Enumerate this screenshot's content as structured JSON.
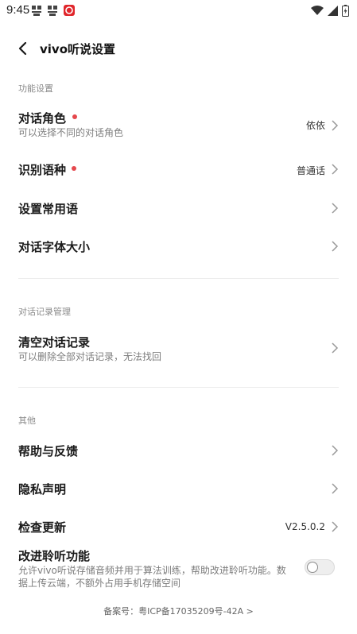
{
  "status_bar": {
    "time": "9:45",
    "icons": [
      "app-notification-icon",
      "app-notification-icon",
      "red-app-icon",
      "wifi-icon",
      "signal-icon",
      "battery-charging-icon"
    ]
  },
  "header": {
    "title": "vivo听说设置",
    "back_icon": "back-arrow-icon"
  },
  "sections": {
    "function": {
      "label": "功能设置"
    },
    "dialog_record": {
      "label": "对话记录管理"
    },
    "other": {
      "label": "其他"
    }
  },
  "items": {
    "role": {
      "label": "对话角色",
      "sub": "可以选择不同的对话角色",
      "value": "依依"
    },
    "language": {
      "label": "识别语种",
      "value": "普通话"
    },
    "phrases": {
      "label": "设置常用语"
    },
    "font_size": {
      "label": "对话字体大小"
    },
    "clear": {
      "label": "清空对话记录",
      "sub": "可以删除全部对话记录，无法找回"
    },
    "help": {
      "label": "帮助与反馈"
    },
    "privacy": {
      "label": "隐私声明"
    },
    "update": {
      "label": "检查更新",
      "value": "V2.5.0.2"
    },
    "improve": {
      "label": "改进聆听功能",
      "sub_line1": "允许vivo听说存储音频并用于算法训练，帮助改进聆听功能。数",
      "sub_line2": "据上传云端，不额外占用手机存储空间",
      "enabled": false
    }
  },
  "footer": {
    "icp": "备案号：粤ICP备17035209号-42A >"
  },
  "colors": {
    "red_dot": "#e5484d",
    "divider": "#ececec",
    "secondary_text": "#7d7d7d"
  }
}
